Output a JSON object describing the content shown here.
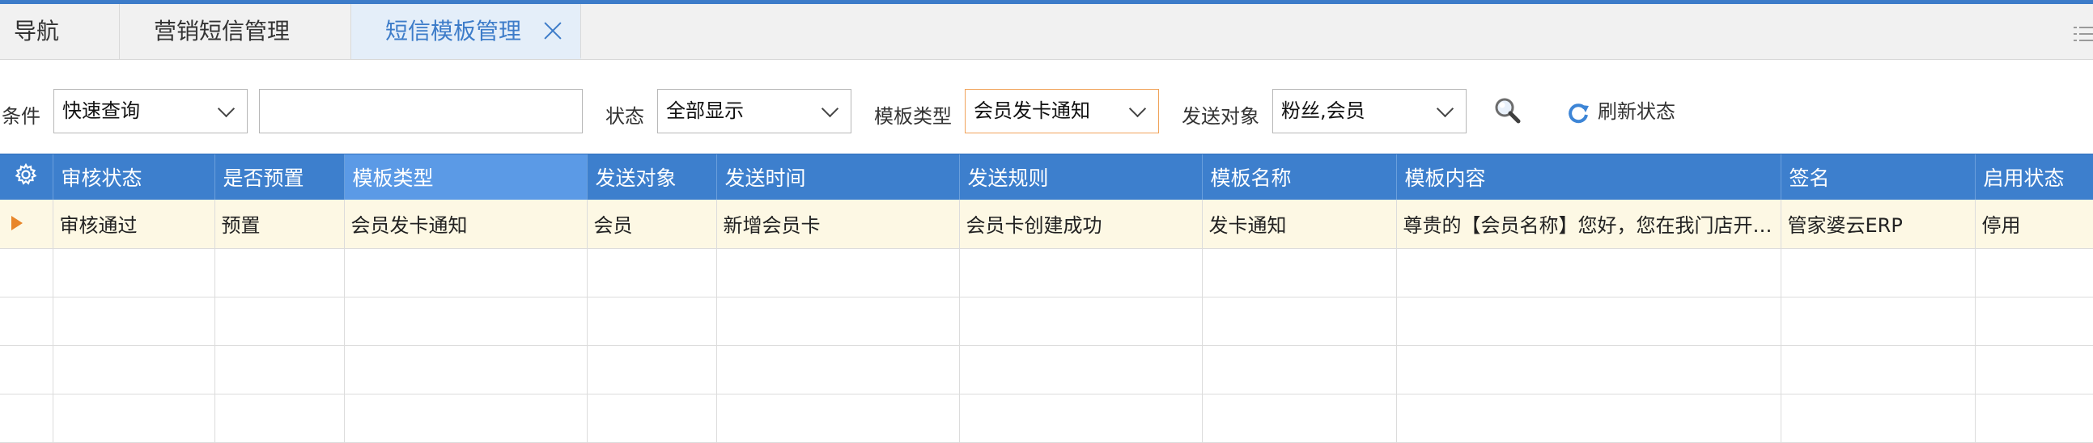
{
  "tabs": {
    "nav": "导航",
    "marketing": "营销短信管理",
    "template": "短信模板管理"
  },
  "filters": {
    "condition_label": "条件",
    "condition_value": "快速查询",
    "keyword_value": "",
    "status_label": "状态",
    "status_value": "全部显示",
    "template_type_label": "模板类型",
    "template_type_value": "会员发卡通知",
    "send_target_label": "发送对象",
    "send_target_value": "粉丝,会员",
    "refresh_label": "刷新状态"
  },
  "grid": {
    "columns": [
      "审核状态",
      "是否预置",
      "模板类型",
      "发送对象",
      "发送时间",
      "发送规则",
      "模板名称",
      "模板内容",
      "签名",
      "启用状态"
    ],
    "rows": [
      [
        "审核通过",
        "预置",
        "会员发卡通知",
        "会员",
        "新增会员卡",
        "会员卡创建成功",
        "发卡通知",
        "尊贵的【会员名称】您好，您在我门店开…",
        "管家婆云ERP",
        "停用"
      ]
    ],
    "empty_row_count": 4
  },
  "colors": {
    "accent": "#3d7cc9",
    "header_bg": "#3d7fcd",
    "sorted_header_bg": "#5b9ae6",
    "selected_row_bg": "#fdf8e4",
    "active_border": "#f0a35a",
    "row_marker": "#e8862a"
  },
  "icons": {
    "tab_close": "close-icon",
    "menu": "menu-lines-icon",
    "search": "search-icon",
    "refresh": "refresh-icon",
    "grid_settings": "gear-icon",
    "row_marker": "triangle-right-icon"
  }
}
